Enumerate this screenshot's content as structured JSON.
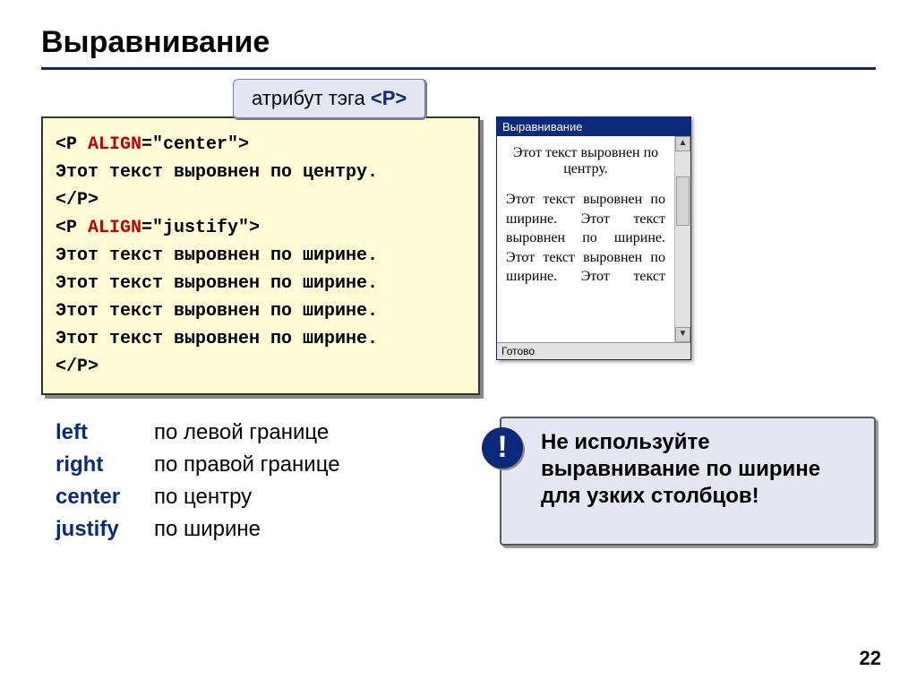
{
  "title": "Выравнивание",
  "callout": {
    "prefix": "атрибут тэга ",
    "tag": "<P>"
  },
  "code": {
    "l1a": "<P ",
    "l1attr": "ALIGN",
    "l1b": "=\"center\">",
    "l2": "Этот текст выровнен по центру.",
    "l3": "</P>",
    "l4a": "<P ",
    "l4attr": "ALIGN",
    "l4b": "=\"justify\">",
    "l5": "Этот текст выровнен по ширине.",
    "l6": "Этот текст выровнен по ширине.",
    "l7": "Этот текст выровнен по ширине.",
    "l8": "Этот текст выровнен по ширине.",
    "l9": "</P>"
  },
  "preview": {
    "title": "Выравнивание",
    "center": "Этот текст выровнен по центру.",
    "justify": "Этот текст выровнен по ширине. Этот текст выровнен по ширине. Этот текст выровнен по ширине. Этот текст",
    "status": "Готово"
  },
  "aligns": {
    "left_kw": "left",
    "left_txt": "по левой границе",
    "right_kw": "right",
    "right_txt": "по правой границе",
    "center_kw": "center",
    "center_txt": "по центру",
    "justify_kw": "justify",
    "justify_txt": "по ширине"
  },
  "warn": {
    "bang": "!",
    "text": "Не используйте выравнивание по ширине для узких столбцов!"
  },
  "slide_num": "22"
}
